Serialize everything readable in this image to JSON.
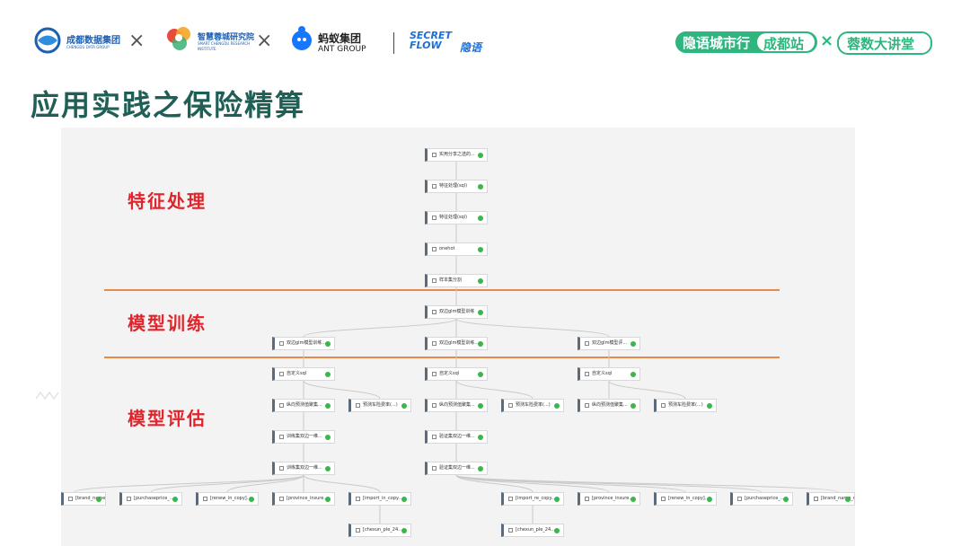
{
  "header": {
    "logos": [
      {
        "name": "chengdu-data-group",
        "text": "成都数据集团",
        "subtext": "CHENGDU DATA GROUP"
      },
      {
        "name": "smart-chengdu-institute",
        "text": "智慧蓉城研究院",
        "subtext": "SMART CHENGDU RESEARCH INSTITUTE"
      },
      {
        "name": "ant-group",
        "text": "蚂蚁集团",
        "subtext": "ANT GROUP"
      },
      {
        "name": "secretflow",
        "text": "SECRET FLOW",
        "subtext": "隐语"
      }
    ],
    "separator": "×",
    "badges": {
      "event": "隐语城市行",
      "city": "成都站",
      "times": "×",
      "lecture": "蓉数大讲堂"
    }
  },
  "slide": {
    "title": "应用实践之保险精算",
    "sections": [
      "特征处理",
      "模型训练",
      "模型评估"
    ]
  },
  "colors": {
    "title": "#1f5f56",
    "section": "#e0242b",
    "divider": "#e8894a",
    "node_status": "#3ab64a",
    "badge_green": "#2fb57e"
  },
  "flow": {
    "nodes": [
      {
        "id": "n1",
        "label": "实用分享之选的..."
      },
      {
        "id": "n2",
        "label": "特征处理(sql)"
      },
      {
        "id": "n3",
        "label": "特征处理(sql)"
      },
      {
        "id": "n4",
        "label": "onehot"
      },
      {
        "id": "n5",
        "label": "样本集分割"
      },
      {
        "id": "n6",
        "label": "双边glm模型训练"
      },
      {
        "id": "n7",
        "label": "双边glm模型训练..."
      },
      {
        "id": "n8",
        "label": "双边glm模型训练..."
      },
      {
        "id": "n9",
        "label": "双边glm模型评..."
      },
      {
        "id": "n10",
        "label": "自定义sql"
      },
      {
        "id": "n11",
        "label": "自定义sql"
      },
      {
        "id": "n12",
        "label": "自定义sql"
      },
      {
        "id": "n13",
        "label": "纵向预测值聚集..."
      },
      {
        "id": "n14",
        "label": "预测车险费率(...)"
      },
      {
        "id": "n15",
        "label": "纵向预测值聚集..."
      },
      {
        "id": "n16",
        "label": "预测车险费率(...)"
      },
      {
        "id": "n17",
        "label": "纵向预测值聚集..."
      },
      {
        "id": "n18",
        "label": "预测车险费率(...)"
      },
      {
        "id": "n19",
        "label": "训练集双边一维..."
      },
      {
        "id": "n20",
        "label": "验证集双边一维..."
      },
      {
        "id": "n21",
        "label": "训练集双边一维..."
      },
      {
        "id": "n22",
        "label": "验证集双边一维..."
      },
      {
        "id": "n23",
        "label": "[brand_name_m..."
      },
      {
        "id": "n24",
        "label": "[purchaseprice_..."
      },
      {
        "id": "n25",
        "label": "[renew_in_copy]..."
      },
      {
        "id": "n26",
        "label": "[province_insure..."
      },
      {
        "id": "n27",
        "label": "[import_in_copy..."
      },
      {
        "id": "n28",
        "label": "[import_re_copy..."
      },
      {
        "id": "n29",
        "label": "[province_insure..."
      },
      {
        "id": "n30",
        "label": "[renew_in_copy]..."
      },
      {
        "id": "n31",
        "label": "[purchaseprice_..."
      },
      {
        "id": "n32",
        "label": "[brand_name_re..."
      },
      {
        "id": "n33",
        "label": "[chexun_ple_24..."
      },
      {
        "id": "n34",
        "label": "[chexun_ple_24..."
      }
    ],
    "edges": [
      [
        "n1",
        "n2"
      ],
      [
        "n2",
        "n3"
      ],
      [
        "n3",
        "n4"
      ],
      [
        "n4",
        "n5"
      ],
      [
        "n5",
        "n6"
      ],
      [
        "n6",
        "n7"
      ],
      [
        "n6",
        "n8"
      ],
      [
        "n6",
        "n9"
      ],
      [
        "n7",
        "n10"
      ],
      [
        "n8",
        "n11"
      ],
      [
        "n9",
        "n12"
      ],
      [
        "n10",
        "n13"
      ],
      [
        "n10",
        "n14"
      ],
      [
        "n11",
        "n15"
      ],
      [
        "n11",
        "n16"
      ],
      [
        "n12",
        "n17"
      ],
      [
        "n12",
        "n18"
      ],
      [
        "n13",
        "n19"
      ],
      [
        "n15",
        "n20"
      ],
      [
        "n19",
        "n21"
      ],
      [
        "n20",
        "n22"
      ],
      [
        "n21",
        "n23"
      ],
      [
        "n21",
        "n24"
      ],
      [
        "n21",
        "n25"
      ],
      [
        "n21",
        "n26"
      ],
      [
        "n21",
        "n27"
      ],
      [
        "n27",
        "n33"
      ],
      [
        "n22",
        "n28"
      ],
      [
        "n22",
        "n29"
      ],
      [
        "n22",
        "n30"
      ],
      [
        "n22",
        "n31"
      ],
      [
        "n22",
        "n32"
      ],
      [
        "n28",
        "n34"
      ]
    ]
  }
}
